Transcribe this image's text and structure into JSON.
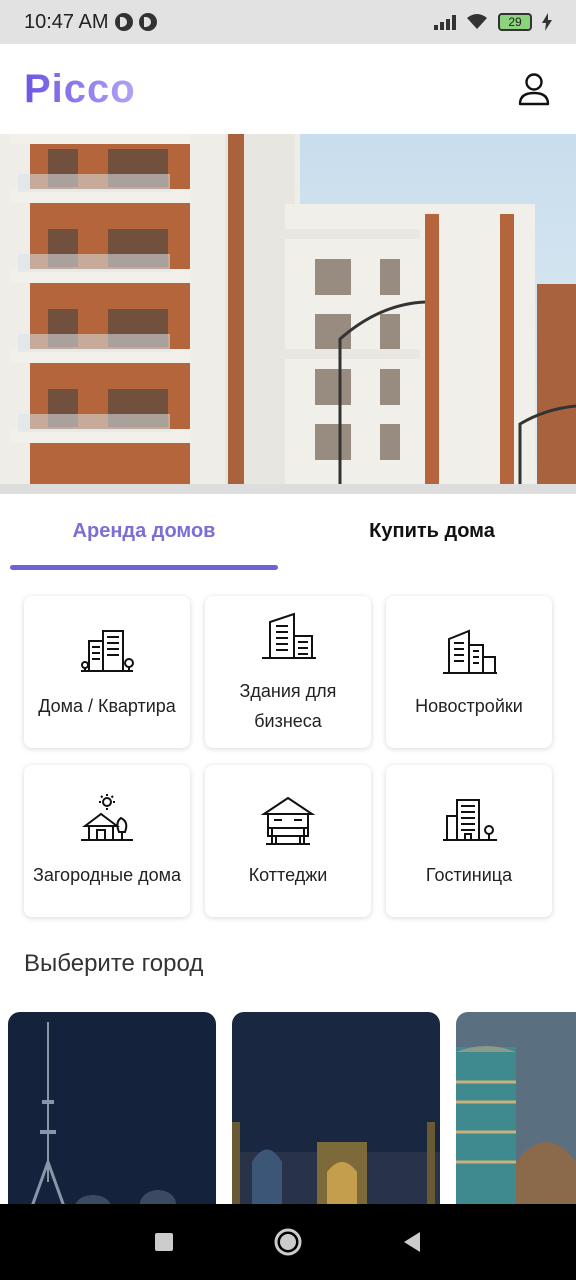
{
  "status_bar": {
    "time": "10:47 AM",
    "battery": "29"
  },
  "header": {
    "logo": "Picco",
    "profile_icon": "user-icon"
  },
  "tabs": [
    {
      "label": "Аренда домов",
      "active": true
    },
    {
      "label": "Купить дома",
      "active": false
    }
  ],
  "categories": [
    {
      "label": "Дома / Квартира",
      "icon": "apartment-building-icon"
    },
    {
      "label": "Здания для бизнеса",
      "icon": "office-building-icon"
    },
    {
      "label": "Новостройки",
      "icon": "new-building-icon"
    },
    {
      "label": "Загородные дома",
      "icon": "country-house-icon"
    },
    {
      "label": "Коттеджи",
      "icon": "cottage-icon"
    },
    {
      "label": "Гостиница",
      "icon": "hotel-icon"
    }
  ],
  "cities_section": {
    "title": "Выберите город"
  },
  "colors": {
    "accent": "#6c63d9",
    "status_bar_bg": "#e2e2e2",
    "nav_bg": "#000000"
  }
}
